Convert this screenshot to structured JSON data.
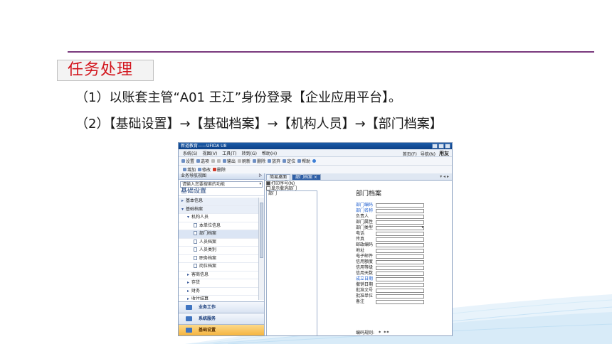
{
  "slide": {
    "title": "任务处理",
    "steps": [
      "（1）以账套主管“A01 王江”身份登录【企业应用平台】。",
      "（2）【基础设置】→【基础档案】→【机构人员】→【部门档案】"
    ],
    "accent_color": "#7a3a7e",
    "title_color": "#d2141c"
  },
  "app": {
    "title": "新道教育——UFIDA U8",
    "menus": [
      "系统(S)",
      "视图(V)",
      "工具(T)",
      "转到(G)",
      "帮助(H)"
    ],
    "menu_right": [
      "首页(F)",
      "导航(N)"
    ],
    "brand": "用友",
    "toolbar": [
      "设置",
      "选项",
      "",
      "",
      "输出",
      "刷新",
      "删除",
      "放弃",
      "定位",
      "帮助"
    ],
    "toolbar2": [
      "增加",
      "修改",
      "删除"
    ],
    "nav_panel_title": "业务导航视图",
    "search_placeholder": "请输入您要搜索的功能",
    "section_title": "基础设置",
    "tree": [
      {
        "label": "基本信息",
        "level": 1,
        "glyph": "▸"
      },
      {
        "label": "基础档案",
        "level": 1,
        "glyph": "▾"
      },
      {
        "label": "机构人员",
        "level": 2,
        "glyph": "▾"
      },
      {
        "label": "本单位信息",
        "level": 3
      },
      {
        "label": "部门档案",
        "level": 3,
        "selected": true
      },
      {
        "label": "人员档案",
        "level": 3
      },
      {
        "label": "人员类别",
        "level": 3
      },
      {
        "label": "职务档案",
        "level": 3
      },
      {
        "label": "岗位档案",
        "level": 3
      },
      {
        "label": "客商信息",
        "level": 2,
        "glyph": "▸"
      },
      {
        "label": "存货",
        "level": 2,
        "glyph": "▸"
      },
      {
        "label": "财务",
        "level": 2,
        "glyph": "▸"
      },
      {
        "label": "收付结算",
        "level": 2,
        "glyph": "▸"
      }
    ],
    "nav_buttons": [
      {
        "label": "业务工作",
        "active": false
      },
      {
        "label": "系统服务",
        "active": false
      },
      {
        "label": "基础设置",
        "active": true
      }
    ],
    "tabs": [
      {
        "label": "简易桌面",
        "active": false
      },
      {
        "label": "部门档案 ×",
        "active": true
      }
    ],
    "options": [
      "打印序号(N)",
      "显示撤消部门"
    ],
    "tree_root": "部门",
    "form_title": "部门档案",
    "fields": [
      {
        "label": "部门编码",
        "required": true
      },
      {
        "label": "部门名称",
        "required": true
      },
      {
        "label": "负责人"
      },
      {
        "label": "部门属性"
      },
      {
        "label": "部门类型",
        "select": true
      },
      {
        "label": "电话"
      },
      {
        "label": "传真"
      },
      {
        "label": "邮政编码"
      },
      {
        "label": "地址"
      },
      {
        "label": "电子邮件"
      },
      {
        "label": "信用额度"
      },
      {
        "label": "信用等级"
      },
      {
        "label": "信用天数"
      },
      {
        "label": "成立日期",
        "required": true
      },
      {
        "label": "撤销日期"
      },
      {
        "label": "批准文号"
      },
      {
        "label": "批准单位"
      },
      {
        "label": "备注"
      }
    ],
    "encode_label": "编码规则:",
    "encode_value": "* **"
  }
}
